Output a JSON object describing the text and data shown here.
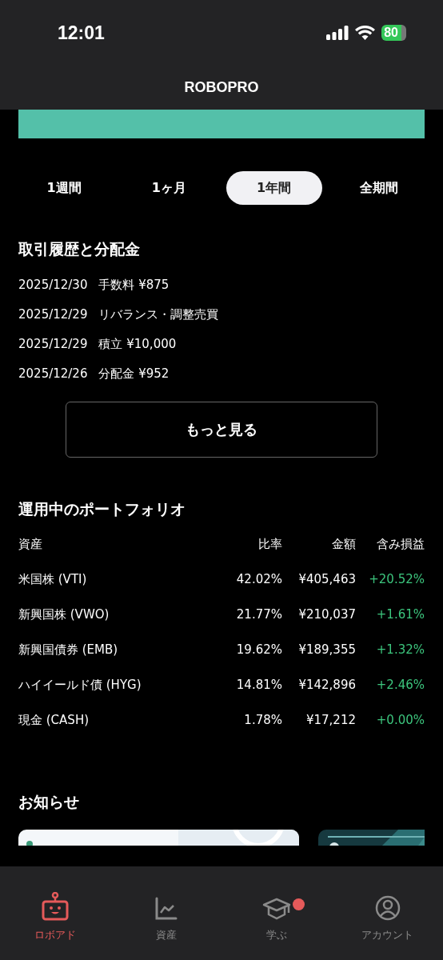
{
  "status_bar": {
    "time": "12:01",
    "battery": "80"
  },
  "header": {
    "title": "ROBOPRO"
  },
  "periods": [
    {
      "label": "1週間",
      "selected": false
    },
    {
      "label": "1ヶ月",
      "selected": false
    },
    {
      "label": "1年間",
      "selected": true
    },
    {
      "label": "全期間",
      "selected": false
    }
  ],
  "history": {
    "title": "取引履歴と分配金",
    "items": [
      {
        "date": "2025/12/30",
        "text": "手数料 ¥875"
      },
      {
        "date": "2025/12/29",
        "text": "リバランス・調整売買"
      },
      {
        "date": "2025/12/29",
        "text": "積立 ¥10,000"
      },
      {
        "date": "2025/12/26",
        "text": "分配金 ¥952"
      }
    ],
    "more_button": "もっと見る"
  },
  "portfolio": {
    "title": "運用中のポートフォリオ",
    "columns": [
      "資産",
      "比率",
      "金額",
      "含み損益"
    ],
    "rows": [
      [
        "米国株 (VTI)",
        "42.02%",
        "¥405,463",
        "+20.52%"
      ],
      [
        "新興国株 (VWO)",
        "21.77%",
        "¥210,037",
        "+1.61%"
      ],
      [
        "新興国債券 (EMB)",
        "19.62%",
        "¥189,355",
        "+1.32%"
      ],
      [
        "ハイイールド債 (HYG)",
        "14.81%",
        "¥142,896",
        "+2.46%"
      ],
      [
        "現金 (CASH)",
        "1.78%",
        "¥17,212",
        "+0.00%"
      ]
    ]
  },
  "news": {
    "title": "お知らせ"
  },
  "tab_bar": [
    {
      "label": "ロボアド",
      "selected": true,
      "badge": false
    },
    {
      "label": "資産",
      "selected": false,
      "badge": false
    },
    {
      "label": "学ぶ",
      "selected": false,
      "badge": true
    },
    {
      "label": "アカウント",
      "selected": false,
      "badge": false
    }
  ]
}
